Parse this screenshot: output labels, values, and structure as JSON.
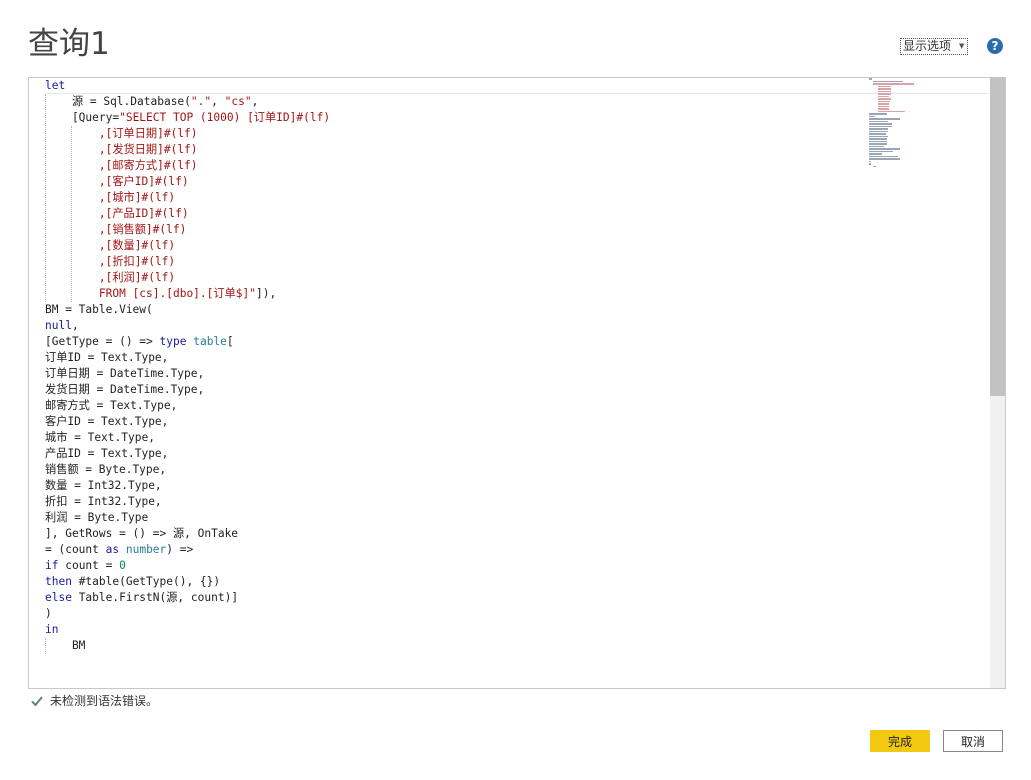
{
  "window": {
    "title": "查询1"
  },
  "toolbar": {
    "display_options_label": "显示选项",
    "help_icon": "help-icon"
  },
  "editor": {
    "lines": [
      "let",
      "    源 = Sql.Database(\".\", \"cs\",",
      "    [Query=\"SELECT TOP (1000) [订单ID]#(lf)",
      "        ,[订单日期]#(lf)",
      "        ,[发货日期]#(lf)",
      "        ,[邮寄方式]#(lf)",
      "        ,[客户ID]#(lf)",
      "        ,[城市]#(lf)",
      "        ,[产品ID]#(lf)",
      "        ,[销售额]#(lf)",
      "        ,[数量]#(lf)",
      "        ,[折扣]#(lf)",
      "        ,[利润]#(lf)",
      "        FROM [cs].[dbo].[订单$]\"]),",
      "BM = Table.View(",
      "null,",
      "[GetType = () => type table[",
      "订单ID = Text.Type,",
      "订单日期 = DateTime.Type,",
      "发货日期 = DateTime.Type,",
      "邮寄方式 = Text.Type,",
      "客户ID = Text.Type,",
      "城市 = Text.Type,",
      "产品ID = Text.Type,",
      "销售额 = Byte.Type,",
      "数量 = Int32.Type,",
      "折扣 = Int32.Type,",
      "利润 = Byte.Type",
      "], GetRows = () => 源, OnTake",
      "= (count as number) =>",
      "if count = 0",
      "then #table(GetType(), {})",
      "else Table.FirstN(源, count)]",
      ")",
      "in",
      "    BM"
    ]
  },
  "status": {
    "message": "未检测到语法错误。",
    "icon": "check-icon",
    "icon_color": "#5b8a72"
  },
  "buttons": {
    "done_label": "完成",
    "cancel_label": "取消"
  },
  "colors": {
    "accent": "#f2c811",
    "keyword": "#1a1aa6",
    "string": "#a31515",
    "number": "#098658",
    "type": "#267f99"
  }
}
